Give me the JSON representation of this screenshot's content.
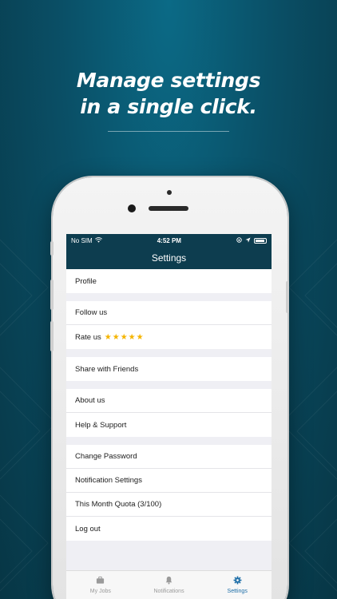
{
  "headline": {
    "line1": "Manage settings",
    "line2": "in a single click."
  },
  "statusbar": {
    "carrier": "No SIM",
    "time": "4:52 PM"
  },
  "navbar": {
    "title": "Settings"
  },
  "settings": {
    "profile": "Profile",
    "follow_us": "Follow us",
    "rate_us": "Rate us",
    "rate_stars": 5,
    "share": "Share with Friends",
    "about": "About us",
    "help": "Help & Support",
    "change_password": "Change Password",
    "notification_settings": "Notification Settings",
    "quota": "This Month Quota (3/100)",
    "logout": "Log out"
  },
  "tabs": [
    {
      "label": "My Jobs",
      "icon": "briefcase-icon",
      "active": false
    },
    {
      "label": "Notifications",
      "icon": "bell-icon",
      "active": false
    },
    {
      "label": "Settings",
      "icon": "gear-icon",
      "active": true
    }
  ],
  "colors": {
    "background": "#0a4f66",
    "navbar": "#0d3d4f",
    "active_tab": "#1e6fa8",
    "star": "#f5b400"
  }
}
